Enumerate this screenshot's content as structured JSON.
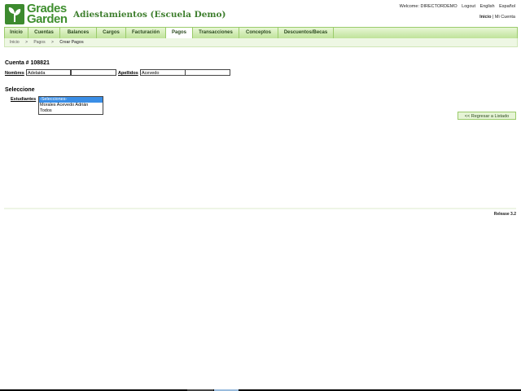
{
  "header": {
    "logo_line1": "Grades",
    "logo_line2": "Garden",
    "school_name": "Adiestamientos (Escuela Demo)",
    "welcome": "Welcome: DIRECTORDEMO",
    "logout": "Logout",
    "lang_en": "English",
    "lang_es": "Español",
    "link_inicio": "Inicio",
    "link_cuenta": "| Mi Cuenta"
  },
  "nav": {
    "tabs": [
      "Inicio",
      "Cuentas",
      "Balances",
      "Cargos",
      "Facturación",
      "Pagos",
      "Transacciones",
      "Conceptos",
      "Descuentos/Becas"
    ],
    "active": "Pagos"
  },
  "breadcrumb": [
    "Inicio",
    ">",
    "Pagos",
    ">",
    "Crear Pagos"
  ],
  "account": {
    "title": "Cuenta # 108821",
    "nombres_label": "Nombres",
    "nombres_value": "Adelaida",
    "nombres_value2": "",
    "apellidos_label": "Apellidos",
    "apellidos_value": "Acevedo",
    "apellidos_value2": ""
  },
  "select_section": {
    "title": "Seleccione",
    "label": "Estudiantes",
    "options": [
      "-Selecciones-",
      "Morales Acevedo Adrián",
      "Todos"
    ],
    "selected_index": 0
  },
  "return_button": "<< Regresar a Listado",
  "footer": {
    "release": "Release 3.2"
  },
  "colors": {
    "accent_green": "#3f8f2f",
    "nav_bg": "#bfe39a",
    "selection_blue": "#3a8ee6"
  }
}
